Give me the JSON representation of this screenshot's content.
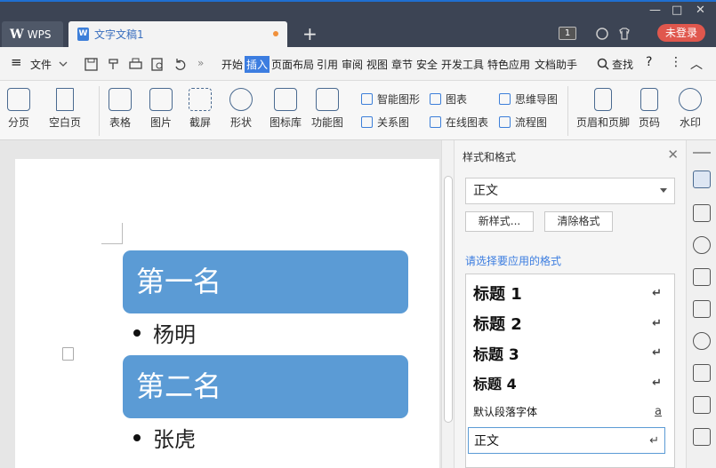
{
  "titlebar": {
    "app_tab": "WPS",
    "app_logo": "W",
    "doc_tab": "文字文稿1",
    "doc_icon": "W",
    "new_tab": "+",
    "page_badge": "1",
    "login": "未登录",
    "minimize": "—",
    "maximize": "□",
    "close": "✕"
  },
  "menu": {
    "hamburger": "≡",
    "file": "文件",
    "items": [
      "开始",
      "插入",
      "页面布局",
      "引用",
      "审阅",
      "视图",
      "章节",
      "安全",
      "开发工具",
      "特色应用",
      "文档助手"
    ],
    "active": "插入",
    "search": "查找",
    "help": "?",
    "more": "⋮",
    "collapse": "︿",
    "more_tabs": "»"
  },
  "ribbon": {
    "large": [
      "分页",
      "空白页",
      "表格",
      "图片",
      "截屏",
      "形状",
      "图标库",
      "功能图",
      "页眉和页脚",
      "页码",
      "水印"
    ],
    "small": [
      "智能图形",
      "图表",
      "思维导图",
      "关系图",
      "在线图表",
      "流程图"
    ]
  },
  "document": {
    "headings": [
      "第一名",
      "第二名"
    ],
    "bullets": [
      "杨明",
      "张虎"
    ]
  },
  "panel": {
    "title": "样式和格式",
    "current_style": "正文",
    "new_style": "新样式...",
    "clear_format": "清除格式",
    "hint": "请选择要应用的格式",
    "styles": [
      "标题 1",
      "标题 2",
      "标题 3",
      "标题 4",
      "默认段落字体",
      "正文"
    ],
    "return_mark": "↵",
    "char_mark": "a"
  },
  "colors": {
    "accent": "#3c7de0",
    "heading_box": "#5b9bd5",
    "login": "#e0574d",
    "titlebar": "#3c4454"
  }
}
